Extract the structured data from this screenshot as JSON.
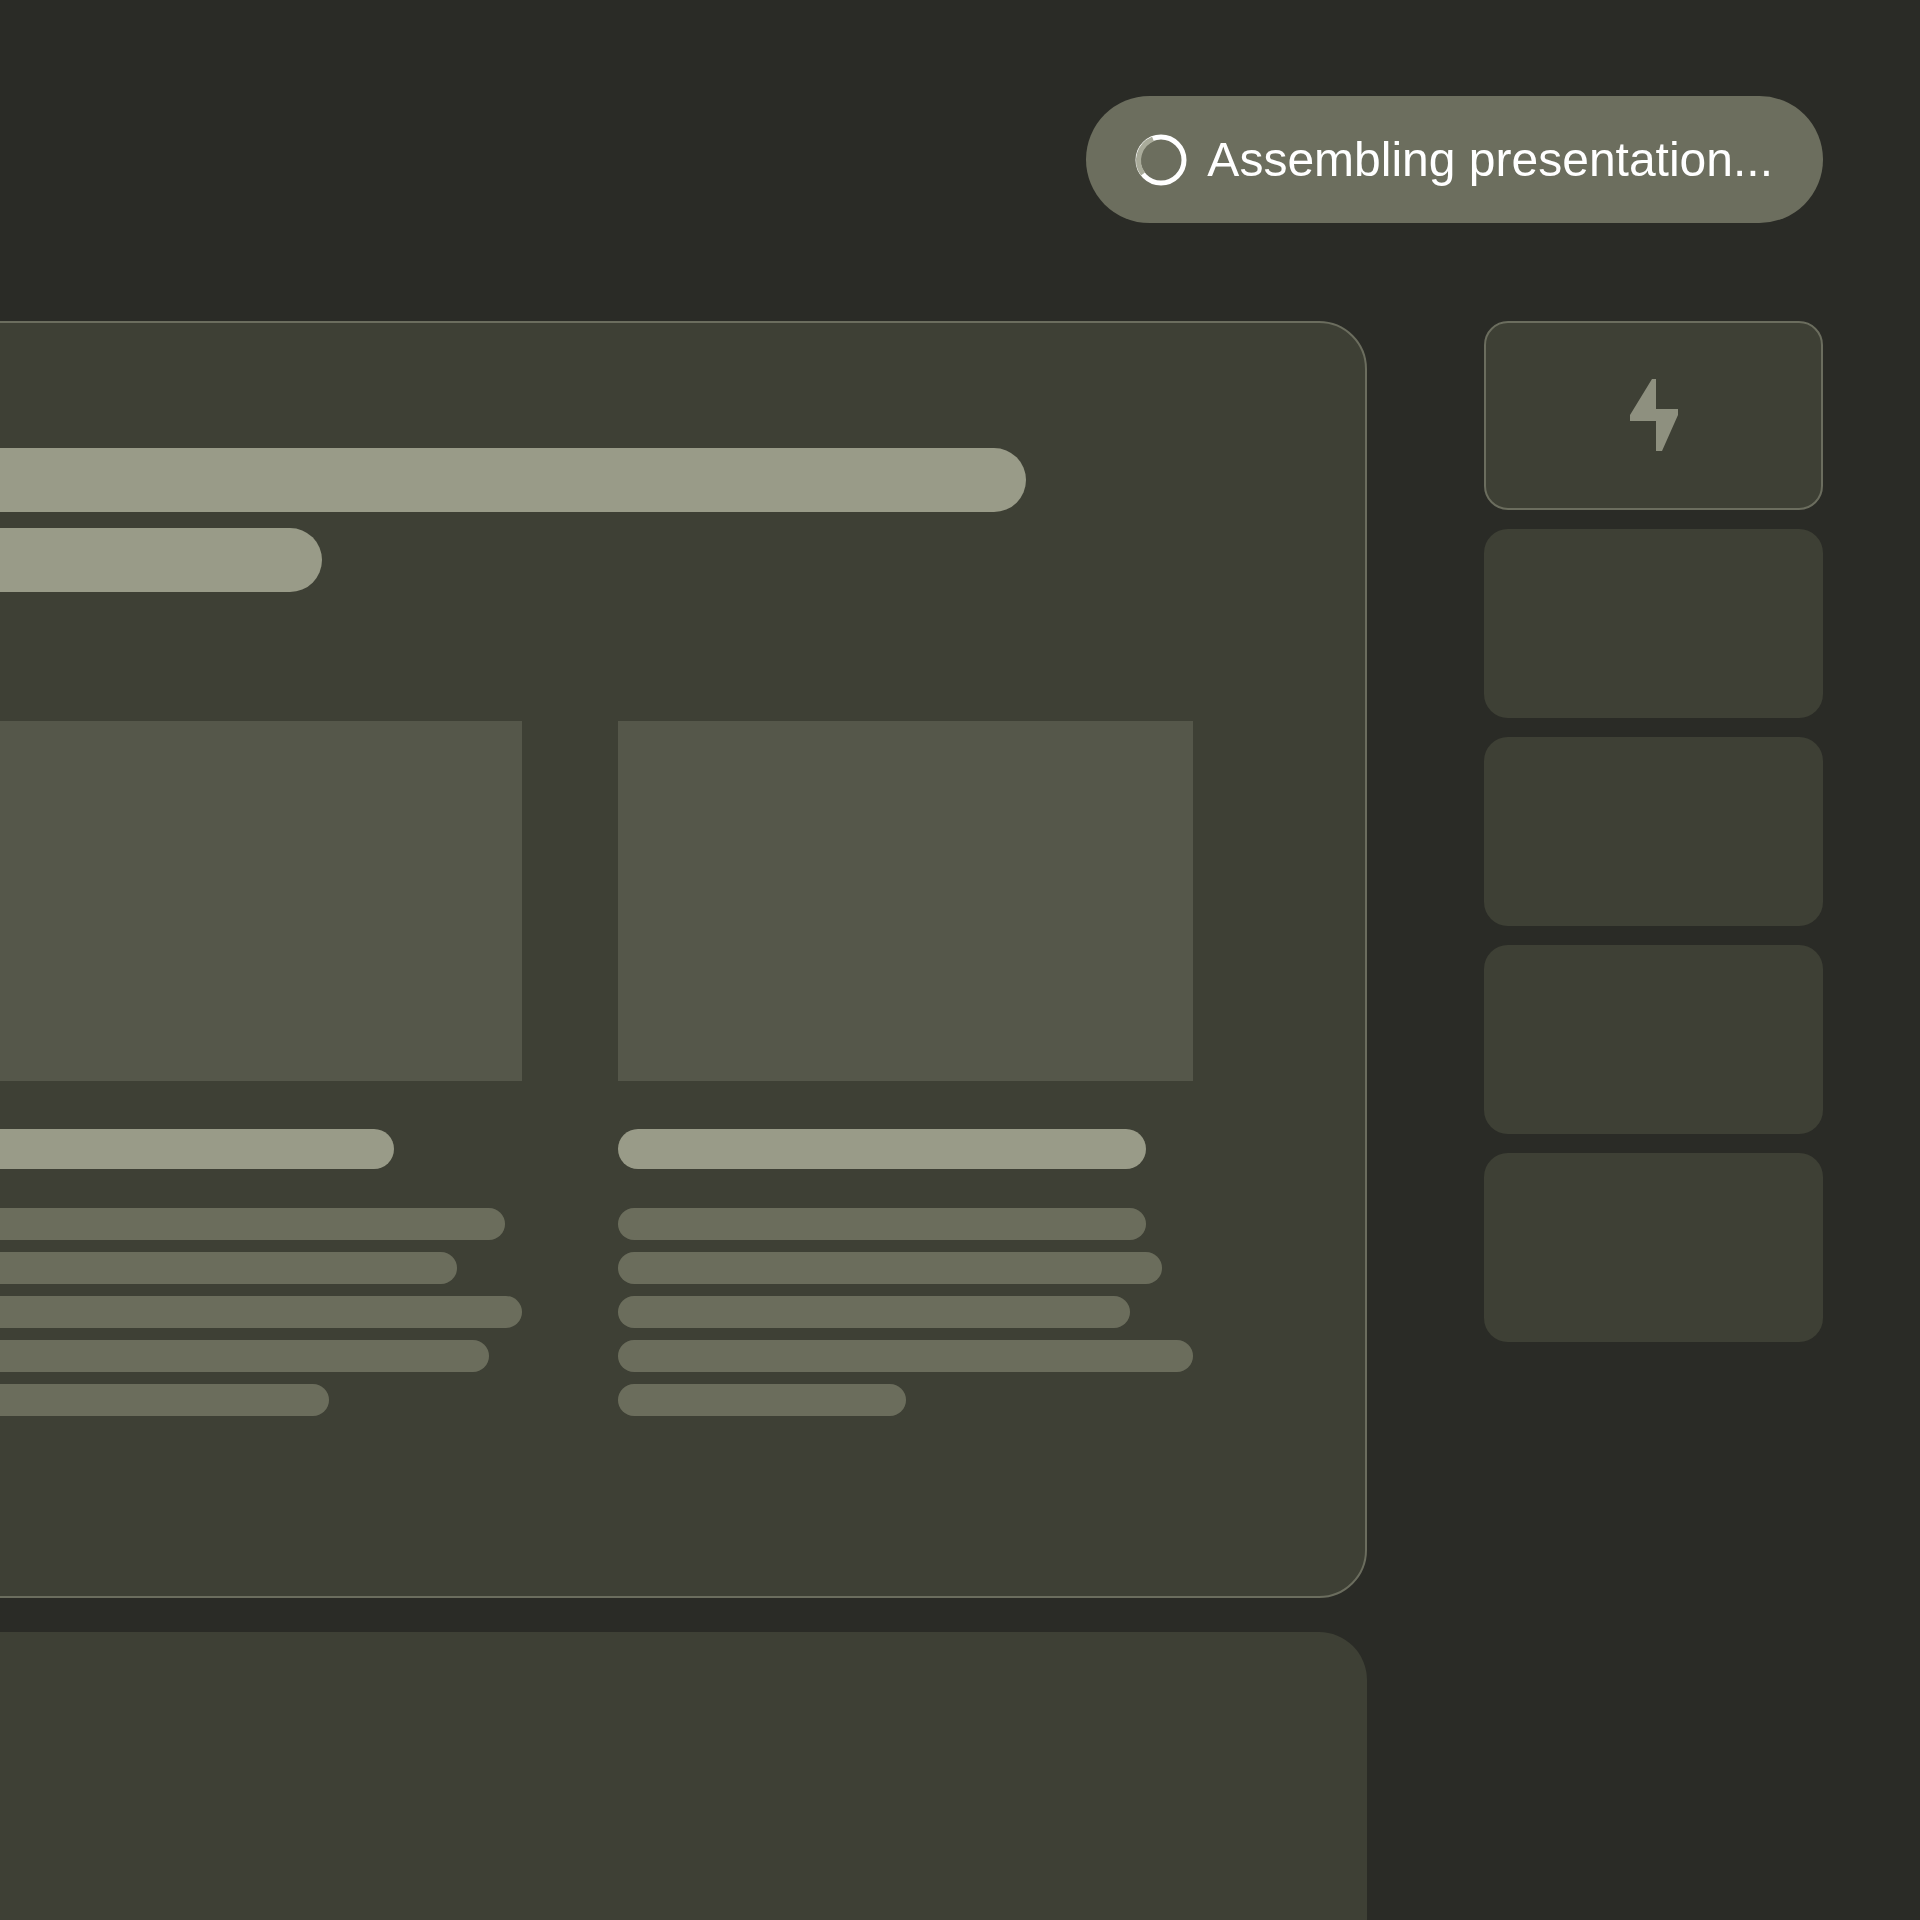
{
  "status": {
    "text": "Assembling presentation..."
  },
  "slides": [
    {
      "selected": true
    },
    {
      "selected": false
    },
    {
      "selected": false
    },
    {
      "selected": false
    },
    {
      "selected": false
    }
  ]
}
